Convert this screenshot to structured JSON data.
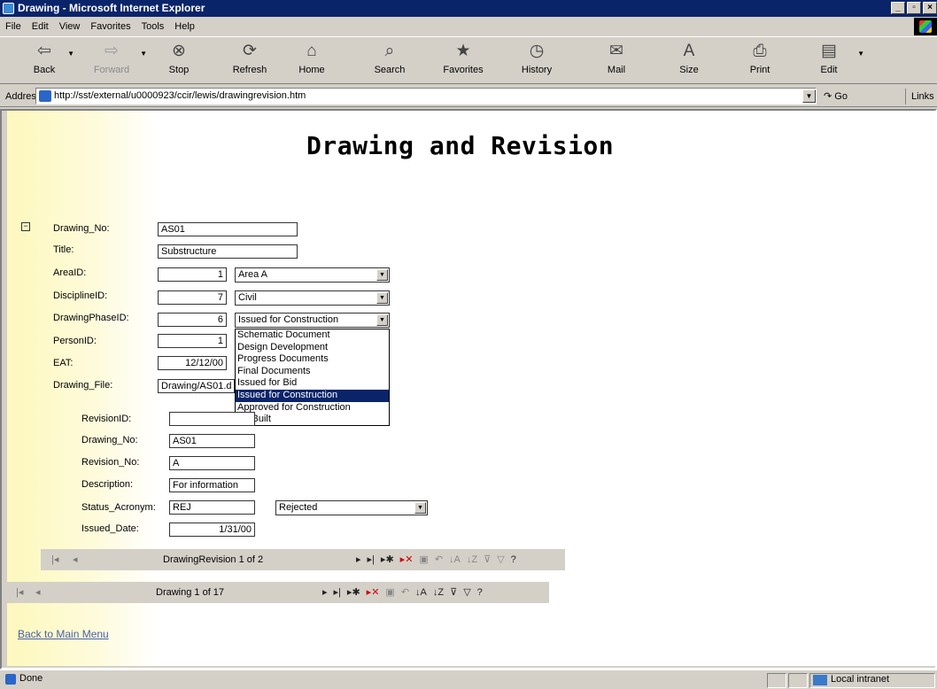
{
  "window": {
    "title": "Drawing - Microsoft Internet Explorer"
  },
  "menu": [
    {
      "label": "File",
      "u": "F"
    },
    {
      "label": "Edit",
      "u": "E"
    },
    {
      "label": "View",
      "u": "V"
    },
    {
      "label": "Favorites",
      "u": "a"
    },
    {
      "label": "Tools",
      "u": "T"
    },
    {
      "label": "Help",
      "u": "H"
    }
  ],
  "toolbar": {
    "back": "Back",
    "forward": "Forward",
    "stop": "Stop",
    "refresh": "Refresh",
    "home": "Home",
    "search": "Search",
    "favorites": "Favorites",
    "history": "History",
    "mail": "Mail",
    "size": "Size",
    "print": "Print",
    "edit": "Edit"
  },
  "address": {
    "label": "Address",
    "url": "http://sst/external/u0000923/ccir/lewis/drawingrevision.htm",
    "go": "Go",
    "links": "Links"
  },
  "page": {
    "heading": "Drawing and Revision",
    "back_link": "Back to Main Menu"
  },
  "drawing": {
    "labels": {
      "drawing_no": "Drawing_No:",
      "title": "Title:",
      "area": "AreaID:",
      "discipline": "DisciplineID:",
      "phase": "DrawingPhaseID:",
      "person": "PersonID:",
      "eat": "EAT:",
      "file": "Drawing_File:"
    },
    "values": {
      "drawing_no": "AS01",
      "title": "Substructure",
      "area_id": "1",
      "area_name": "Area A",
      "discipline_id": "7",
      "discipline_name": "Civil",
      "phase_id": "6",
      "phase_name": "Issued for Construction",
      "person_id": "1",
      "eat": "12/12/00",
      "file": "Drawing/AS01.d"
    }
  },
  "phase_options": [
    "Schematic Document",
    "Design Development",
    "Progress Documents",
    "Final Documents",
    "Issued for Bid",
    "Issued for Construction",
    "Approved for Construction",
    "As-Built"
  ],
  "phase_selected_index": 5,
  "revision": {
    "labels": {
      "revision_id": "RevisionID:",
      "drawing_no": "Drawing_No:",
      "revision_no": "Revision_No:",
      "description": "Description:",
      "status": "Status_Acronym:",
      "issued": "Issued_Date:"
    },
    "values": {
      "revision_id": "",
      "drawing_no": "AS01",
      "revision_no": "A",
      "description": "For information",
      "status": "REJ",
      "status_name": "Rejected",
      "issued": "1/31/00"
    }
  },
  "nav_revision": {
    "text": "DrawingRevision 1 of 2"
  },
  "nav_drawing": {
    "text": "Drawing 1 of 17"
  },
  "status": {
    "text": "Done",
    "zone": "Local intranet"
  },
  "colors": {
    "title_bar": "#0a246a",
    "selection": "#0a246a",
    "page_gradient": "#fdf8bd",
    "link": "#4860a8"
  }
}
